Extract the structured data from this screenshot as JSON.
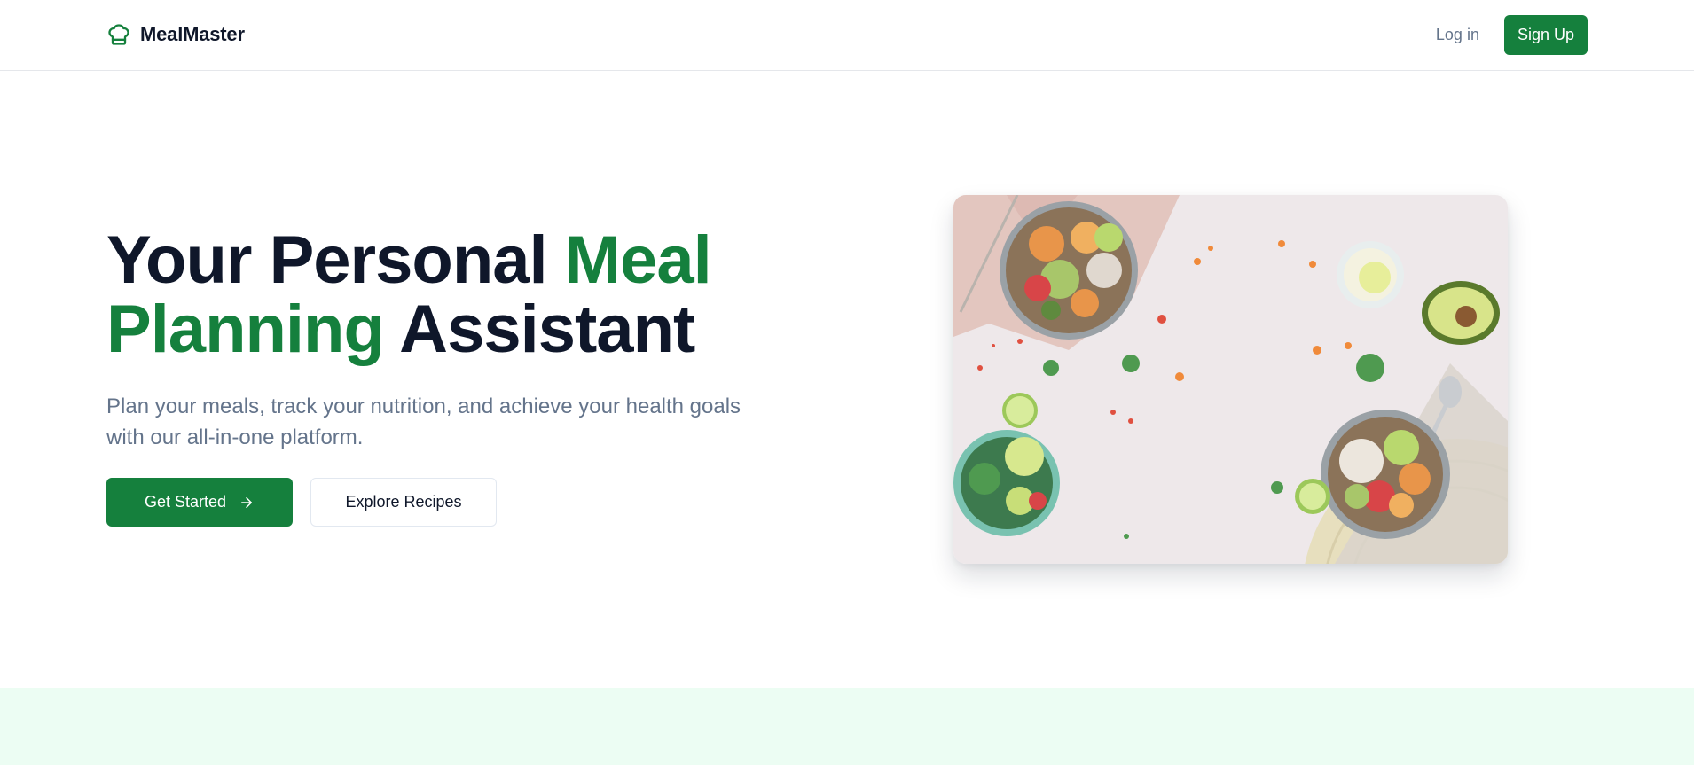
{
  "brand": {
    "name": "MealMaster",
    "logo_icon": "chef-hat-icon",
    "color": "#15803d"
  },
  "nav": {
    "login_label": "Log in",
    "signup_label": "Sign Up"
  },
  "hero": {
    "title_part1": "Your Personal ",
    "title_accent": "Meal Planning",
    "title_part2": " Assistant",
    "subtitle": "Plan your meals, track your nutrition, and achieve your health goals with our all-in-one platform.",
    "primary_cta": "Get Started",
    "primary_cta_icon": "arrow-right-icon",
    "secondary_cta": "Explore Recipes"
  },
  "colors": {
    "accent": "#15803d",
    "heading": "#0f172a",
    "muted_text": "#64748b",
    "band_background": "#ecfdf3"
  }
}
